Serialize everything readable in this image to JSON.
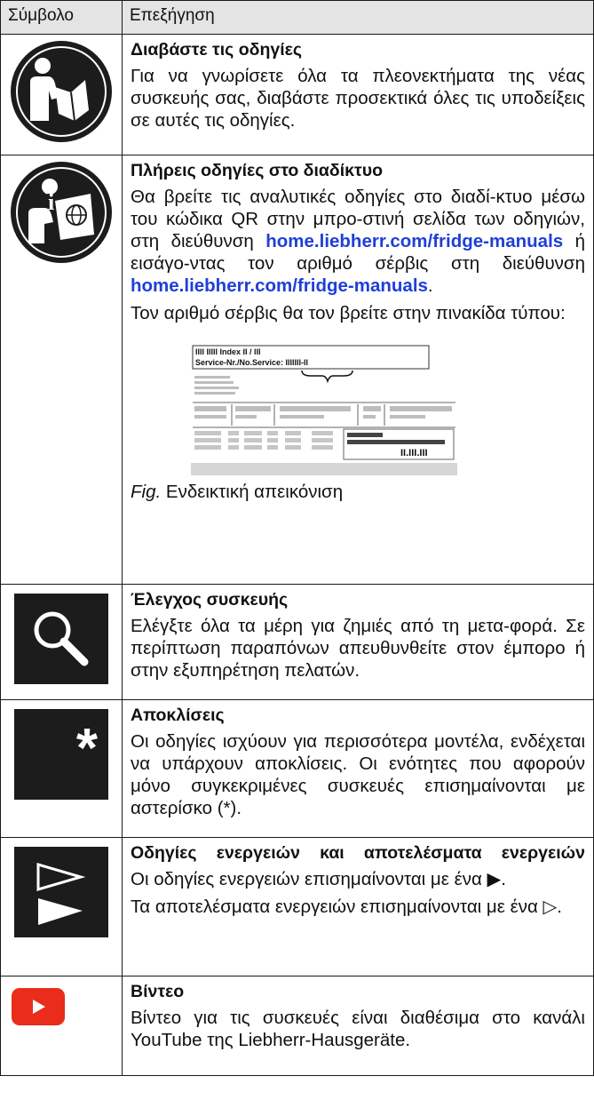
{
  "header": {
    "col_symbol": "Σύμβολο",
    "col_explanation": "Επεξήγηση"
  },
  "rows": {
    "read": {
      "icon": "read-instructions-icon",
      "title": "Διαβάστε τις οδηγίες",
      "text": "Για να γνωρίσετε όλα τα πλεονεκτήματα της νέας συσκευής σας, διαβάστε προσεκτικά όλες τις υποδείξεις σε αυτές τις οδηγίες."
    },
    "online": {
      "icon": "online-manual-icon",
      "title": "Πλήρεις οδηγίες στο διαδίκτυο",
      "text1_a": "Θα βρείτε τις αναλυτικές οδηγίες στο διαδί-κτυο μέσω του κώδικα QR στην μπρο-στινή σελίδα των οδηγιών, στη διεύθυνση",
      "link1": "home.liebherr.com/fridge-manuals",
      "text1_b": "ή εισάγο-ντας τον αριθμό σέρβις στη διεύθυνση",
      "link2": "home.liebherr.com/fridge-manuals",
      "text1_c": ".",
      "text2": "Τον αριθμό σέρβις θα τον βρείτε στην πινακίδα τύπου:",
      "plate": {
        "line1": "IIII IIIII  Index  II / III",
        "line2": "Service-Nr./No.Service: IIIIIII-II",
        "code": "II.III.III"
      },
      "caption_fig": "Fig.",
      "caption_text": "Ενδεικτική απεικόνιση"
    },
    "check": {
      "icon": "magnifier-icon",
      "title": "Έλεγχος συσκευής",
      "text": "Ελέγξτε όλα τα μέρη για ζημιές από τη μετα-φορά. Σε περίπτωση παραπόνων απευθυνθείτε στον έμπορο ή στην εξυπηρέτηση πελατών."
    },
    "deviations": {
      "icon": "asterisk-icon",
      "title": "Αποκλίσεις",
      "text": "Οι οδηγίες ισχύουν για περισσότερα μοντέλα, ενδέχεται να υπάρχουν αποκλίσεις. Οι ενότητες που αφορούν μόνο συγκεκριμένες συσκευές επισημαίνονται με αστερίσκο (*)."
    },
    "actions": {
      "icon": "action-triangles-icon",
      "title": "Οδηγίες ενεργειών και αποτελέσματα ενεργειών",
      "text1": "Οι οδηγίες ενεργειών επισημαίνονται με ένα ▶.",
      "text2": "Τα αποτελέσματα ενεργειών επισημαίνονται με ένα ▷."
    },
    "video": {
      "icon": "youtube-icon",
      "title": "Βίντεο",
      "text": "Βίντεο για τις συσκευές είναι διαθέσιμα στο κανάλι YouTube της Liebherr-Hausgeräte."
    }
  },
  "colors": {
    "link": "#1f3fd6",
    "youtube": "#ea2c1a",
    "header_bg": "#e4e4e4"
  }
}
